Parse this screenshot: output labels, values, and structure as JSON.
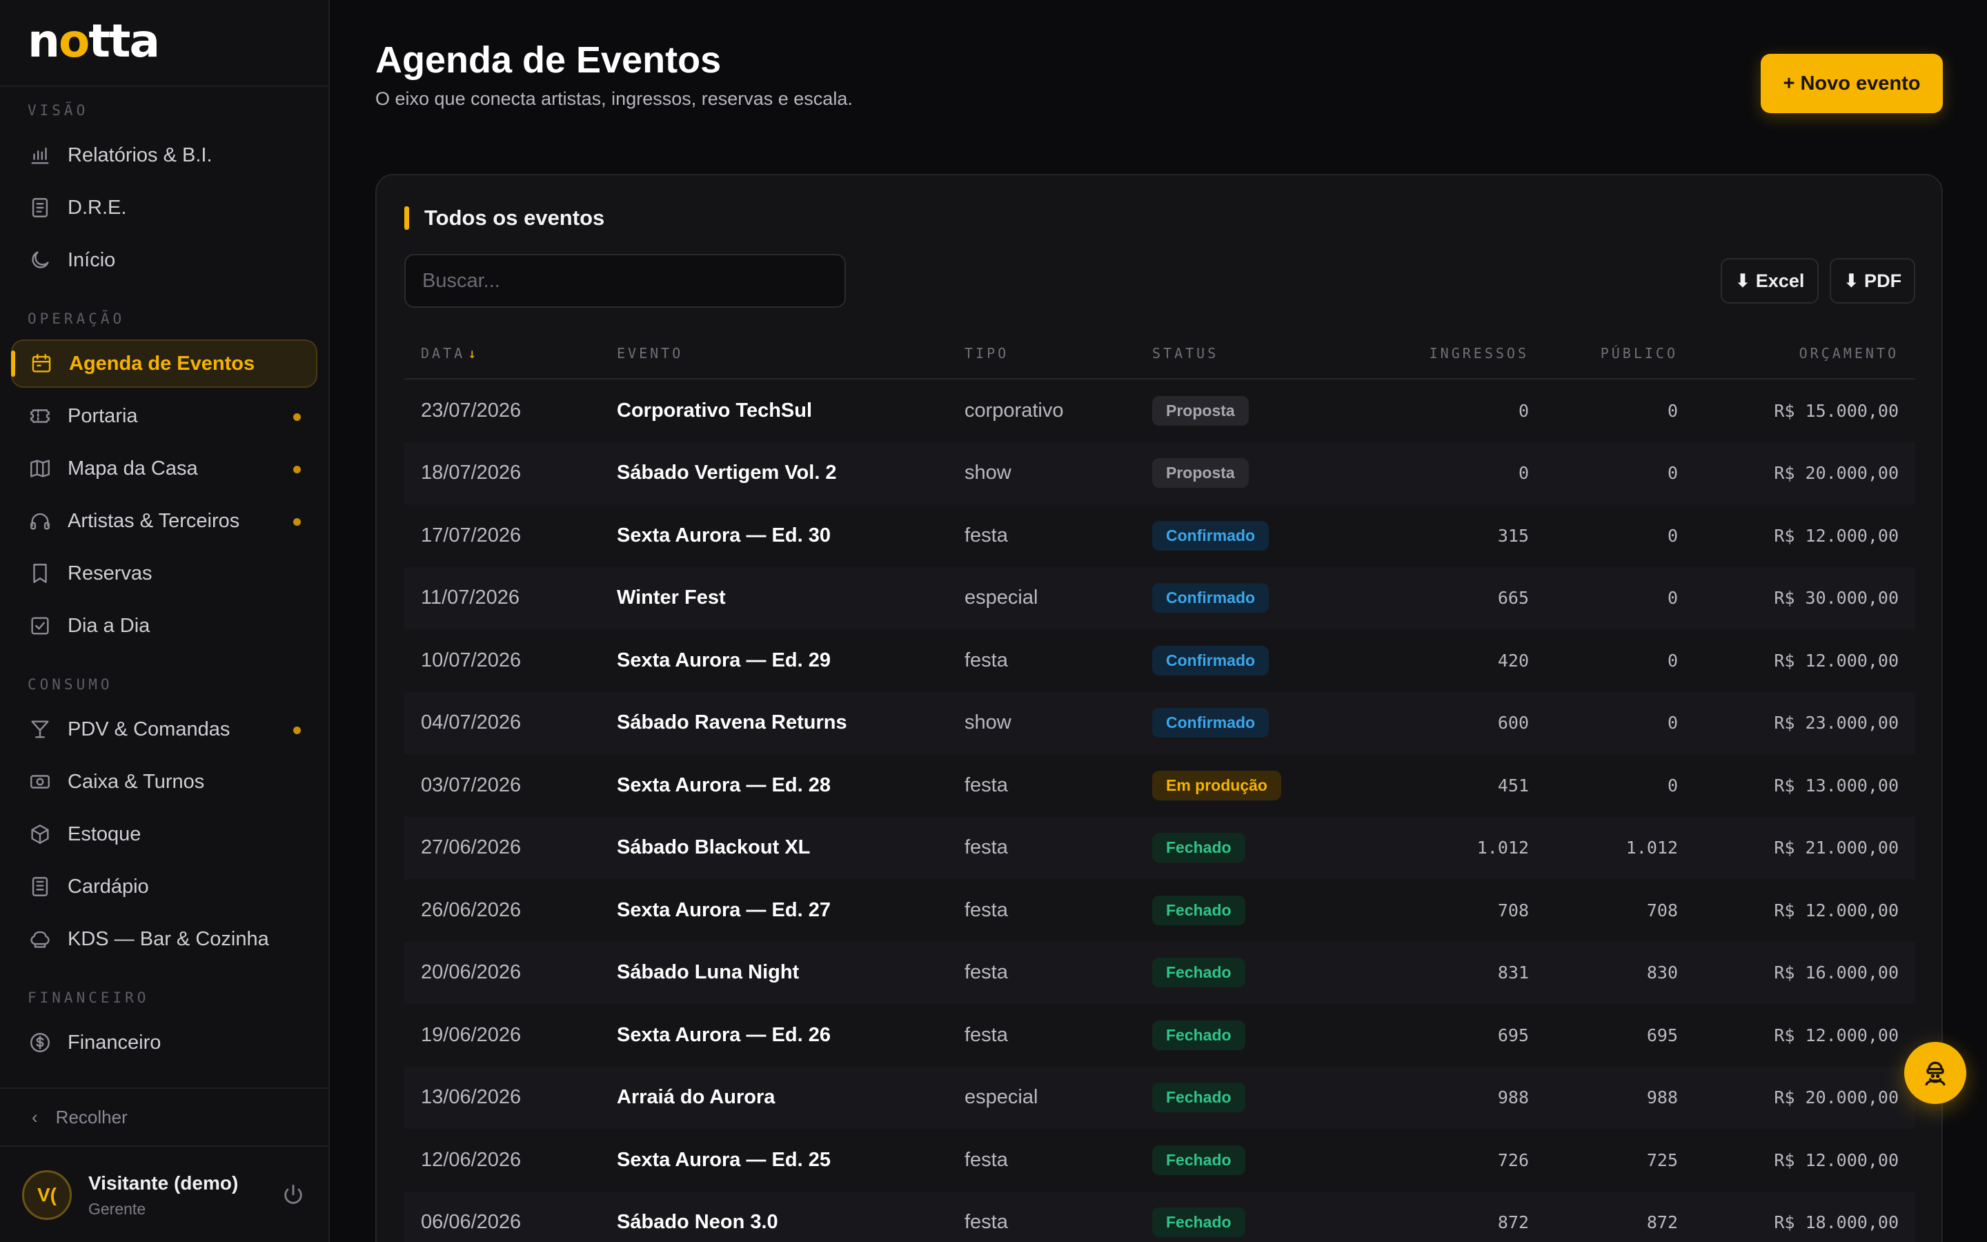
{
  "brand": {
    "logo_pre": "n",
    "logo_moon": "o",
    "logo_post": "tta"
  },
  "sidebar": {
    "sections": [
      {
        "label": "VISÃO",
        "items": [
          {
            "label": "Relatórios & B.I.",
            "icon": "bar-chart-icon"
          },
          {
            "label": "D.R.E.",
            "icon": "document-icon"
          },
          {
            "label": "Início",
            "icon": "moon-icon"
          }
        ]
      },
      {
        "label": "OPERAÇÃO",
        "items": [
          {
            "label": "Agenda de Eventos",
            "icon": "calendar-icon",
            "active": true
          },
          {
            "label": "Portaria",
            "icon": "ticket-icon",
            "dot": true
          },
          {
            "label": "Mapa da Casa",
            "icon": "map-icon",
            "dot": true
          },
          {
            "label": "Artistas & Terceiros",
            "icon": "headphones-icon",
            "dot": true
          },
          {
            "label": "Reservas",
            "icon": "bookmark-icon"
          },
          {
            "label": "Dia a Dia",
            "icon": "check-square-icon"
          }
        ]
      },
      {
        "label": "CONSUMO",
        "items": [
          {
            "label": "PDV & Comandas",
            "icon": "cocktail-icon",
            "dot": true
          },
          {
            "label": "Caixa & Turnos",
            "icon": "cash-icon"
          },
          {
            "label": "Estoque",
            "icon": "box-icon"
          },
          {
            "label": "Cardápio",
            "icon": "menu-book-icon"
          },
          {
            "label": "KDS — Bar & Cozinha",
            "icon": "chef-hat-icon"
          }
        ]
      },
      {
        "label": "FINANCEIRO",
        "items": [
          {
            "label": "Financeiro",
            "icon": "dollar-circle-icon"
          }
        ]
      }
    ],
    "collapse_label": "Recolher",
    "user": {
      "initials": "V(",
      "name": "Visitante (demo)",
      "role": "Gerente"
    }
  },
  "header": {
    "title": "Agenda de Eventos",
    "subtitle": "O eixo que conecta artistas, ingressos, reservas e escala.",
    "new_button": "+ Novo evento"
  },
  "card": {
    "title": "Todos os eventos",
    "search_placeholder": "Buscar...",
    "excel_label": "⬇ Excel",
    "pdf_label": "⬇ PDF",
    "columns": {
      "data": "DATA",
      "evento": "EVENTO",
      "tipo": "TIPO",
      "status": "STATUS",
      "ingressos": "INGRESSOS",
      "publico": "PÚBLICO",
      "orcamento": "ORÇAMENTO"
    },
    "rows": [
      {
        "data": "23/07/2026",
        "evento": "Corporativo TechSul",
        "tipo": "corporativo",
        "status": "Proposta",
        "status_kind": "proposta",
        "ingressos": "0",
        "publico": "0",
        "orcamento": "R$ 15.000,00"
      },
      {
        "data": "18/07/2026",
        "evento": "Sábado Vertigem Vol. 2",
        "tipo": "show",
        "status": "Proposta",
        "status_kind": "proposta",
        "ingressos": "0",
        "publico": "0",
        "orcamento": "R$ 20.000,00"
      },
      {
        "data": "17/07/2026",
        "evento": "Sexta Aurora — Ed. 30",
        "tipo": "festa",
        "status": "Confirmado",
        "status_kind": "confirmado",
        "ingressos": "315",
        "publico": "0",
        "orcamento": "R$ 12.000,00"
      },
      {
        "data": "11/07/2026",
        "evento": "Winter Fest",
        "tipo": "especial",
        "status": "Confirmado",
        "status_kind": "confirmado",
        "ingressos": "665",
        "publico": "0",
        "orcamento": "R$ 30.000,00"
      },
      {
        "data": "10/07/2026",
        "evento": "Sexta Aurora — Ed. 29",
        "tipo": "festa",
        "status": "Confirmado",
        "status_kind": "confirmado",
        "ingressos": "420",
        "publico": "0",
        "orcamento": "R$ 12.000,00"
      },
      {
        "data": "04/07/2026",
        "evento": "Sábado Ravena Returns",
        "tipo": "show",
        "status": "Confirmado",
        "status_kind": "confirmado",
        "ingressos": "600",
        "publico": "0",
        "orcamento": "R$ 23.000,00"
      },
      {
        "data": "03/07/2026",
        "evento": "Sexta Aurora — Ed. 28",
        "tipo": "festa",
        "status": "Em produção",
        "status_kind": "producao",
        "ingressos": "451",
        "publico": "0",
        "orcamento": "R$ 13.000,00"
      },
      {
        "data": "27/06/2026",
        "evento": "Sábado Blackout XL",
        "tipo": "festa",
        "status": "Fechado",
        "status_kind": "fechado",
        "ingressos": "1.012",
        "publico": "1.012",
        "orcamento": "R$ 21.000,00"
      },
      {
        "data": "26/06/2026",
        "evento": "Sexta Aurora — Ed. 27",
        "tipo": "festa",
        "status": "Fechado",
        "status_kind": "fechado",
        "ingressos": "708",
        "publico": "708",
        "orcamento": "R$ 12.000,00"
      },
      {
        "data": "20/06/2026",
        "evento": "Sábado Luna Night",
        "tipo": "festa",
        "status": "Fechado",
        "status_kind": "fechado",
        "ingressos": "831",
        "publico": "830",
        "orcamento": "R$ 16.000,00"
      },
      {
        "data": "19/06/2026",
        "evento": "Sexta Aurora — Ed. 26",
        "tipo": "festa",
        "status": "Fechado",
        "status_kind": "fechado",
        "ingressos": "695",
        "publico": "695",
        "orcamento": "R$ 12.000,00"
      },
      {
        "data": "13/06/2026",
        "evento": "Arraiá do Aurora",
        "tipo": "especial",
        "status": "Fechado",
        "status_kind": "fechado",
        "ingressos": "988",
        "publico": "988",
        "orcamento": "R$ 20.000,00"
      },
      {
        "data": "12/06/2026",
        "evento": "Sexta Aurora — Ed. 25",
        "tipo": "festa",
        "status": "Fechado",
        "status_kind": "fechado",
        "ingressos": "726",
        "publico": "725",
        "orcamento": "R$ 12.000,00"
      },
      {
        "data": "06/06/2026",
        "evento": "Sábado Neon 3.0",
        "tipo": "festa",
        "status": "Fechado",
        "status_kind": "fechado",
        "ingressos": "872",
        "publico": "872",
        "orcamento": "R$ 18.000,00"
      }
    ]
  },
  "fab": {
    "icon": "assistant-icon"
  },
  "colors": {
    "accent": "#f5b301",
    "background": "#0b0b0d",
    "sidebar": "#111114",
    "card": "#141417"
  }
}
